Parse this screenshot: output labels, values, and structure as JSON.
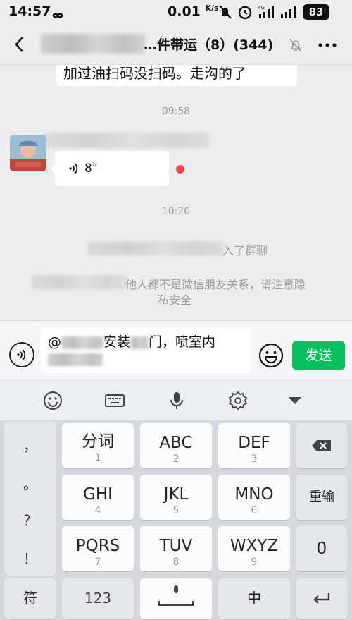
{
  "status_bar": {
    "time": "14:57",
    "speed": "0.01",
    "speed_unit": "K/s",
    "network": "4G",
    "battery": "83"
  },
  "header": {
    "title": "…件带运（8）(344)",
    "back_icon": "back-arrow-icon",
    "mute_icon": "bell-muted-icon",
    "more_icon": "more-icon"
  },
  "chat": {
    "top_message": "加过油扫码没扫码。走沟的了",
    "timestamp_1": "09:58",
    "voice_duration": "8\"",
    "timestamp_2": "10:20",
    "system_join": "入了群聊",
    "system_warning_line1": "他人都不是微信朋友关系，请注意隐",
    "system_warning_line2": "私安全"
  },
  "input": {
    "text_prefix": "@",
    "text_mid": "安装",
    "text_end": "门，喷室内",
    "send_label": "发送"
  },
  "keyboard_toolbar": [
    "emoji-icon",
    "keyboard-icon",
    "microphone-icon",
    "settings-icon",
    "collapse-icon"
  ],
  "keyboard": {
    "punctuation": [
      "，",
      "。",
      "？",
      "！"
    ],
    "keys": [
      {
        "main": "分词",
        "sub": "1"
      },
      {
        "main": "ABC",
        "sub": "2"
      },
      {
        "main": "DEF",
        "sub": "3"
      },
      {
        "main": "GHI",
        "sub": "4"
      },
      {
        "main": "JKL",
        "sub": "5"
      },
      {
        "main": "MNO",
        "sub": "6"
      },
      {
        "main": "PQRS",
        "sub": "7"
      },
      {
        "main": "TUV",
        "sub": "8"
      },
      {
        "main": "WXYZ",
        "sub": "9"
      }
    ],
    "reenter": "重输",
    "zero": "0",
    "symbols": "符",
    "num_mode": "123",
    "chinese": "中"
  },
  "colors": {
    "send_green": "#07c160",
    "unread_red": "#f0484a"
  }
}
